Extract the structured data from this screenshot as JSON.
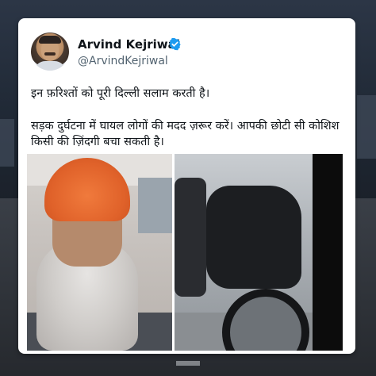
{
  "tweet": {
    "display_name": "Arvind Kejriwal",
    "handle": "@ArvindKejriwal",
    "verified": true,
    "text_line1": "इन फ़रिश्तों को पूरी दिल्ली सलाम करती है।",
    "text_line2": "सड़क दुर्घटना में घायल लोगों की मदद ज़रूर करें। आपकी छोटी सी कोशिश किसी की ज़िंदगी बचा सकती है।"
  },
  "icons": {
    "verified": "verified-badge-icon"
  },
  "colors": {
    "verified_blue": "#1d9bf0",
    "name_text": "#0f1419",
    "handle_text": "#536471",
    "card_bg": "#ffffff"
  }
}
